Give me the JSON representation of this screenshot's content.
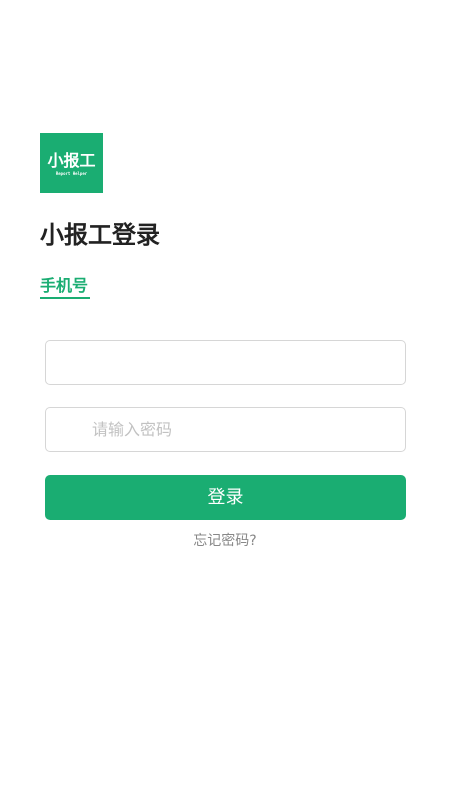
{
  "logo": {
    "main_text": "小报工",
    "sub_text": "Report Helper",
    "bg_color": "#1aad72"
  },
  "page_title": "小报工登录",
  "tabs": {
    "phone_label": "手机号"
  },
  "form": {
    "phone_value": "",
    "phone_placeholder": "",
    "password_value": "",
    "password_placeholder": "请输入密码"
  },
  "login_button_label": "登录",
  "forgot_password_label": "忘记密码?",
  "colors": {
    "accent": "#1aad72",
    "title_text": "#222222",
    "placeholder": "#c2c2c2",
    "muted_text": "#888888",
    "field_border": "#d6d6d6"
  }
}
